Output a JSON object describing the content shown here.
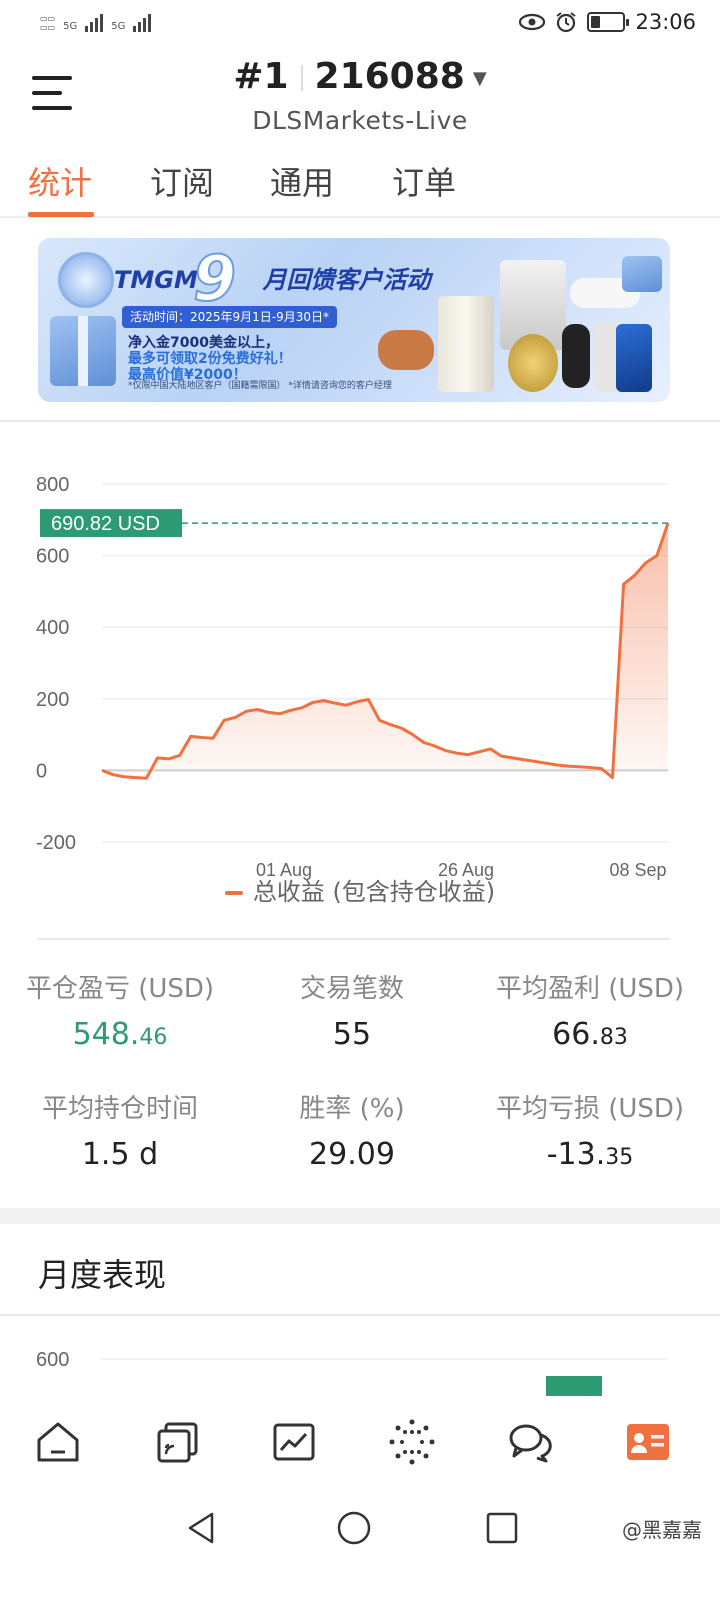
{
  "status_bar": {
    "net1": "5G",
    "net2": "5G",
    "time": "23:06"
  },
  "header": {
    "account_prefix": "#1",
    "account_number": "216088",
    "server": "DLSMarkets-Live"
  },
  "tabs": [
    "统计",
    "订阅",
    "通用",
    "订单"
  ],
  "banner": {
    "brand": "TMGM",
    "nine": "9",
    "title": "月回馈客户活动",
    "date": "活动时间：2025年9月1日-9月30日*",
    "line1": "净入金7000美金以上，",
    "line2": "最多可领取2份免费好礼！",
    "line3": "最高价值¥2000！",
    "note": "*仅限中国大陆地区客户（国籍需限国）  *详情请咨询您的客户经理"
  },
  "chart_data": {
    "type": "area",
    "series": [
      {
        "name": "总收益 (包含持仓收益)",
        "color": "#f07040",
        "values": [
          0,
          -12,
          -18,
          -20,
          -22,
          35,
          32,
          42,
          95,
          92,
          90,
          140,
          148,
          165,
          170,
          162,
          158,
          168,
          175,
          190,
          195,
          188,
          182,
          192,
          198,
          140,
          128,
          118,
          100,
          78,
          68,
          55,
          48,
          44,
          52,
          60,
          40,
          35,
          30,
          25,
          20,
          15,
          12,
          10,
          8,
          5,
          -20,
          520,
          545,
          580,
          600,
          690.82
        ]
      }
    ],
    "x_ticks": [
      "01 Aug",
      "26 Aug",
      "08 Sep"
    ],
    "y_ticks": [
      800,
      600,
      400,
      200,
      0,
      -200
    ],
    "ylim": [
      -200,
      800
    ],
    "last_value_label": "690.82 USD",
    "last_value": 690.82,
    "grid": true
  },
  "legend_label": "总收益 (包含持仓收益)",
  "stats": [
    {
      "label": "平仓盈亏 (USD)",
      "main": "548.",
      "frac": "46",
      "style": "green"
    },
    {
      "label": "交易笔数",
      "main": "55",
      "frac": "",
      "style": "normal"
    },
    {
      "label": "平均盈利 (USD)",
      "main": "66.",
      "frac": "83",
      "style": "normal"
    },
    {
      "label": "平均持仓时间",
      "main": "1.5 d",
      "frac": "",
      "style": "normal"
    },
    {
      "label": "胜率 (%)",
      "main": "29.09",
      "frac": "",
      "style": "normal"
    },
    {
      "label": "平均亏损 (USD)",
      "main": "-13.",
      "frac": "35",
      "style": "normal"
    }
  ],
  "monthly": {
    "title": "月度表现",
    "y_tick_top": "600"
  },
  "watermark": "@黑嘉嘉",
  "colors": {
    "accent": "#f07040",
    "positive": "#2c9b74"
  }
}
